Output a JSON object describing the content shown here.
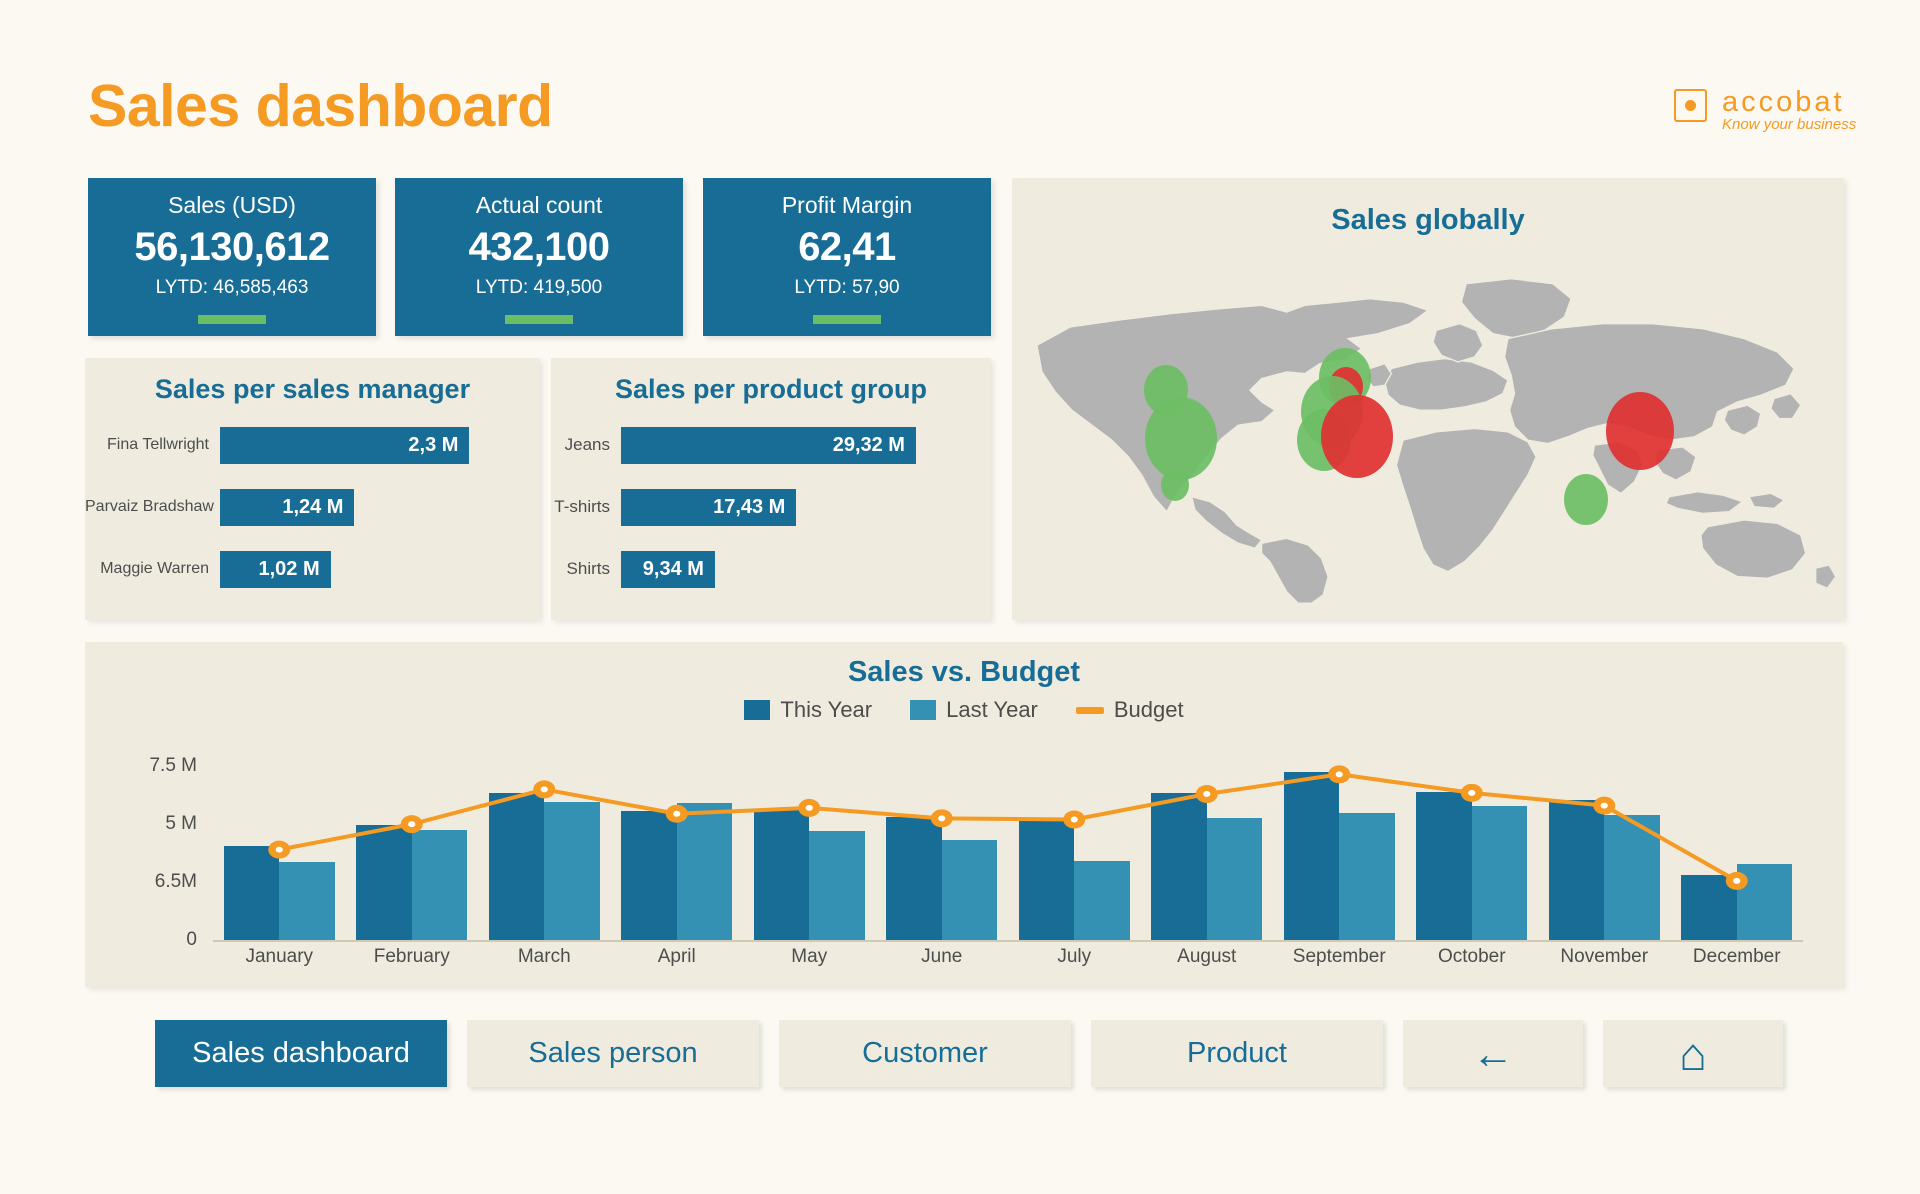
{
  "header": {
    "title": "Sales dashboard",
    "logo": {
      "wordmark": "accobat",
      "tagline": "Know your business",
      "color": "#f59a23"
    }
  },
  "kpis": [
    {
      "label": "Sales (USD)",
      "value": "56,130,612",
      "sub": "LYTD: 46,585,463",
      "indicator_color": "#6cbe64"
    },
    {
      "label": "Actual count",
      "value": "432,100",
      "sub": "LYTD: 419,500",
      "indicator_color": "#6cbe64"
    },
    {
      "label": "Profit Margin",
      "value": "62,41",
      "sub": "LYTD: 57,90",
      "indicator_color": "#6cbe64"
    }
  ],
  "panels": {
    "sales_manager_title": "Sales per sales manager",
    "product_group_title": "Sales per product group",
    "map_title": "Sales globally",
    "chart_title": "Sales vs. Budget"
  },
  "nav": {
    "items": [
      {
        "label": "Sales dashboard",
        "active": true,
        "size": "lg"
      },
      {
        "label": "Sales person",
        "active": false,
        "size": "lg"
      },
      {
        "label": "Customer",
        "active": false,
        "size": "lg"
      },
      {
        "label": "Product",
        "active": false,
        "size": "lg"
      },
      {
        "label": "←",
        "active": false,
        "size": "sm",
        "icon": "back-arrow-icon"
      },
      {
        "label": "⌂",
        "active": false,
        "size": "sm",
        "icon": "home-icon"
      }
    ]
  },
  "theme": {
    "background": "#fbf9f2",
    "panel_bg": "#efecdf",
    "accent_blue": "#186d96",
    "accent_blue_light": "#3591b4",
    "accent_orange": "#f59a23",
    "green": "#6cbe64",
    "red": "#e03131",
    "map_land": "#b3b3b3"
  },
  "chart_data": [
    {
      "type": "bar",
      "title": "Sales per sales manager",
      "orientation": "horizontal",
      "categories": [
        "Fina Tellwright",
        "Parvaiz Bradshaw",
        "Maggie Warren"
      ],
      "values": [
        2.3,
        1.24,
        1.02
      ],
      "value_labels": [
        "2,3 M",
        "1,24 M",
        "1,02 M"
      ],
      "bar_color": "#186d96",
      "xlabel": "",
      "ylabel": "",
      "grid": false,
      "legend": "none",
      "xlim": [
        0,
        2.6
      ]
    },
    {
      "type": "bar",
      "title": "Sales per product group",
      "orientation": "horizontal",
      "categories": [
        "Jeans",
        "T-shirts",
        "Shirts"
      ],
      "values": [
        29.32,
        17.43,
        9.34
      ],
      "value_labels": [
        "29,32 M",
        "17,43 M",
        "9,34 M"
      ],
      "bar_color": "#186d96",
      "xlabel": "",
      "ylabel": "",
      "grid": false,
      "legend": "none",
      "xlim": [
        0,
        33
      ]
    },
    {
      "type": "bar",
      "title": "Sales vs. Budget",
      "subtitle": "",
      "categories": [
        "January",
        "February",
        "March",
        "April",
        "May",
        "June",
        "July",
        "August",
        "September",
        "October",
        "November",
        "December"
      ],
      "series": [
        {
          "name": "This Year",
          "type": "bar",
          "color": "#186d96",
          "values": [
            4.05,
            4.95,
            6.35,
            5.55,
            5.65,
            5.3,
            5.2,
            6.35,
            7.25,
            6.4,
            6.05,
            2.8
          ]
        },
        {
          "name": "Last Year",
          "type": "bar",
          "color": "#3591b4",
          "values": [
            3.35,
            4.75,
            5.95,
            5.9,
            4.7,
            4.3,
            3.4,
            5.25,
            5.5,
            5.8,
            5.4,
            3.3
          ]
        },
        {
          "name": "Budget",
          "type": "line",
          "color": "#f59a23",
          "values": [
            3.9,
            5.0,
            6.5,
            5.45,
            5.7,
            5.25,
            5.2,
            6.3,
            7.15,
            6.35,
            5.8,
            2.55
          ]
        }
      ],
      "ylabel": "",
      "xlabel": "",
      "ytick_labels": [
        "7.5 M",
        "5 M",
        "6.5M",
        "0"
      ],
      "ytick_values": [
        7.5,
        5.0,
        2.5,
        0
      ],
      "ylim": [
        0,
        8.2
      ],
      "grid": false,
      "legend": "top-center"
    },
    {
      "type": "scatter",
      "title": "Sales globally",
      "map": "world",
      "points": [
        {
          "label": "",
          "x_pct": 18.5,
          "y_pct": 40.0,
          "size": 22,
          "color": "#6cbe64"
        },
        {
          "label": "",
          "x_pct": 20.3,
          "y_pct": 53.5,
          "size": 36,
          "color": "#6cbe64"
        },
        {
          "label": "",
          "x_pct": 19.6,
          "y_pct": 66.5,
          "size": 14,
          "color": "#6cbe64"
        },
        {
          "label": "",
          "x_pct": 40.0,
          "y_pct": 36.5,
          "size": 26,
          "color": "#6cbe64"
        },
        {
          "label": "",
          "x_pct": 40.1,
          "y_pct": 39.0,
          "size": 17,
          "color": "#e03131"
        },
        {
          "label": "",
          "x_pct": 38.5,
          "y_pct": 46.0,
          "size": 31,
          "color": "#6cbe64"
        },
        {
          "label": "",
          "x_pct": 37.5,
          "y_pct": 54.0,
          "size": 27,
          "color": "#6cbe64"
        },
        {
          "label": "",
          "x_pct": 41.5,
          "y_pct": 53.0,
          "size": 36,
          "color": "#e03131"
        },
        {
          "label": "",
          "x_pct": 75.5,
          "y_pct": 51.5,
          "size": 34,
          "color": "#e03131"
        },
        {
          "label": "",
          "x_pct": 69.0,
          "y_pct": 70.5,
          "size": 22,
          "color": "#6cbe64"
        }
      ]
    }
  ]
}
